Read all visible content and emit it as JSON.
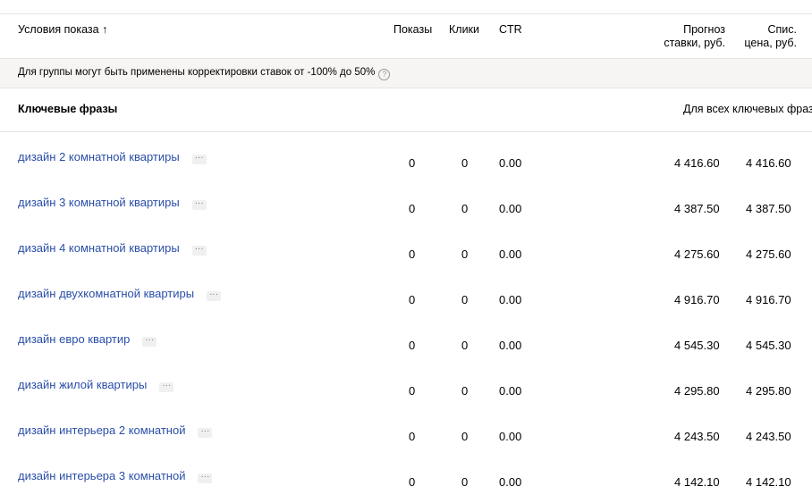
{
  "header": {
    "conditions": "Условия показа",
    "sort_arrow": "↑",
    "shows": "Показы",
    "clicks": "Клики",
    "ctr": "CTR",
    "forecast_line1": "Прогноз",
    "forecast_line2": "ставки, руб.",
    "price_line1": "Спис.",
    "price_line2": "цена, руб."
  },
  "note": {
    "text": "Для группы могут быть применены корректировки ставок от -100% до 50%",
    "help": "?"
  },
  "section": {
    "title": "Ключевые фразы",
    "all_label": "Для всех ключевых фраз:"
  },
  "rows": [
    {
      "phrase": "дизайн 2 комнатной квартиры",
      "shows": "0",
      "clicks": "0",
      "ctr": "0.00",
      "forecast": "4 416.60",
      "price": "4 416.60"
    },
    {
      "phrase": "дизайн 3 комнатной квартиры",
      "shows": "0",
      "clicks": "0",
      "ctr": "0.00",
      "forecast": "4 387.50",
      "price": "4 387.50"
    },
    {
      "phrase": "дизайн 4 комнатной квартиры",
      "shows": "0",
      "clicks": "0",
      "ctr": "0.00",
      "forecast": "4 275.60",
      "price": "4 275.60"
    },
    {
      "phrase": "дизайн двухкомнатной квартиры",
      "shows": "0",
      "clicks": "0",
      "ctr": "0.00",
      "forecast": "4 916.70",
      "price": "4 916.70"
    },
    {
      "phrase": "дизайн евро квартир",
      "shows": "0",
      "clicks": "0",
      "ctr": "0.00",
      "forecast": "4 545.30",
      "price": "4 545.30"
    },
    {
      "phrase": "дизайн жилой квартиры",
      "shows": "0",
      "clicks": "0",
      "ctr": "0.00",
      "forecast": "4 295.80",
      "price": "4 295.80"
    },
    {
      "phrase": "дизайн интерьера 2 комнатной",
      "shows": "0",
      "clicks": "0",
      "ctr": "0.00",
      "forecast": "4 243.50",
      "price": "4 243.50"
    },
    {
      "phrase": "дизайн интерьера 3 комнатной",
      "shows": "0",
      "clicks": "0",
      "ctr": "0.00",
      "forecast": "4 142.10",
      "price": "4 142.10"
    }
  ],
  "more_glyph": "···"
}
